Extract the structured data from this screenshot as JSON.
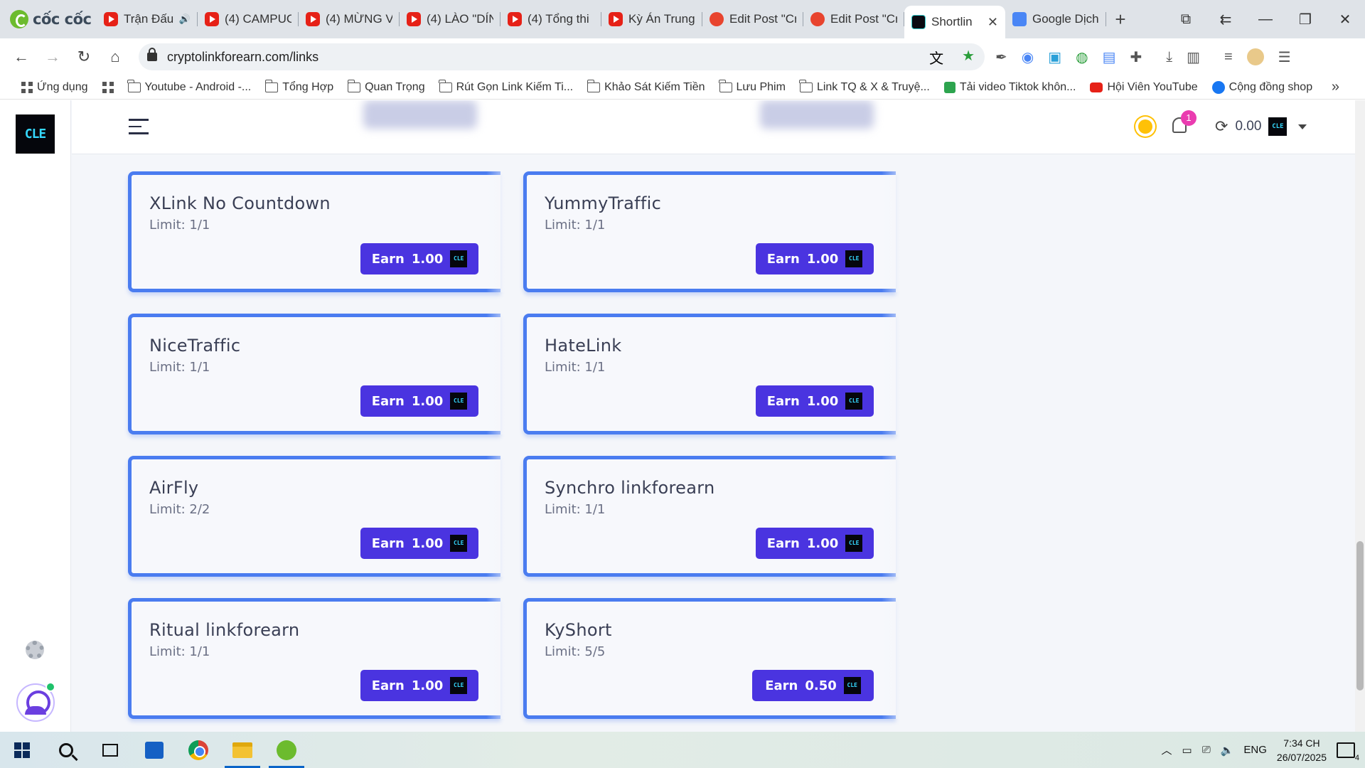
{
  "browser": {
    "brand": "cốc cốc",
    "tabs": [
      {
        "label": "Trận Đấu",
        "icon": "youtube-icon",
        "extra": "🔊"
      },
      {
        "label": "(4) CAMPUC",
        "icon": "youtube-icon"
      },
      {
        "label": "(4) MỪNG V",
        "icon": "youtube-icon"
      },
      {
        "label": "(4) LÀO \"DÍN",
        "icon": "youtube-icon"
      },
      {
        "label": "(4) Tổng thi",
        "icon": "youtube-icon"
      },
      {
        "label": "Kỳ Án Trung",
        "icon": "youtube-icon"
      },
      {
        "label": "Edit Post \"Cr",
        "icon": "wordpress-icon"
      },
      {
        "label": "Edit Post \"Cr",
        "icon": "wordpress-icon"
      },
      {
        "label": "Shortlin",
        "icon": "cle-icon",
        "active": true
      },
      {
        "label": "Google Dịch",
        "icon": "google-translate-icon"
      }
    ],
    "new_tab": "+",
    "url": "cryptolinkforearn.com/links",
    "bookmarks": [
      {
        "label": "Ứng dụng",
        "type": "apps"
      },
      {
        "label": "",
        "type": "grid"
      },
      {
        "label": "Youtube - Android -...",
        "type": "folder"
      },
      {
        "label": "Tổng Hợp",
        "type": "folder"
      },
      {
        "label": "Quan Trọng",
        "type": "folder"
      },
      {
        "label": "Rút Gọn Link Kiếm Ti...",
        "type": "folder"
      },
      {
        "label": "Khảo Sát Kiếm Tiền",
        "type": "folder"
      },
      {
        "label": "Lưu Phim",
        "type": "folder"
      },
      {
        "label": "Link TQ & X & Truyệ...",
        "type": "folder"
      },
      {
        "label": "Tải video Tiktok khôn...",
        "type": "download"
      },
      {
        "label": "Hội Viên YouTube",
        "type": "youtube"
      },
      {
        "label": "Cộng đồng shop",
        "type": "facebook"
      }
    ]
  },
  "site": {
    "logo_text": "CLE",
    "notification_count": "1",
    "balance": "0.00",
    "coin_label": "CLE",
    "earn_label": "Earn",
    "cards": [
      {
        "title": "XLink No Countdown",
        "limit": "Limit: 1/1",
        "reward": "1.00"
      },
      {
        "title": "YummyTraffic",
        "limit": "Limit: 1/1",
        "reward": "1.00"
      },
      {
        "title": "NiceTraffic",
        "limit": "Limit: 1/1",
        "reward": "1.00"
      },
      {
        "title": "HateLink",
        "limit": "Limit: 1/1",
        "reward": "1.00"
      },
      {
        "title": "AirFly",
        "limit": "Limit: 2/2",
        "reward": "1.00"
      },
      {
        "title": "Synchro linkforearn",
        "limit": "Limit: 1/1",
        "reward": "1.00"
      },
      {
        "title": "Ritual linkforearn",
        "limit": "Limit: 1/1",
        "reward": "1.00"
      },
      {
        "title": "KyShort",
        "limit": "Limit: 5/5",
        "reward": "0.50"
      }
    ]
  },
  "taskbar": {
    "language": "ENG",
    "time": "7:34 CH",
    "date": "26/07/2025",
    "notifications": "4"
  }
}
